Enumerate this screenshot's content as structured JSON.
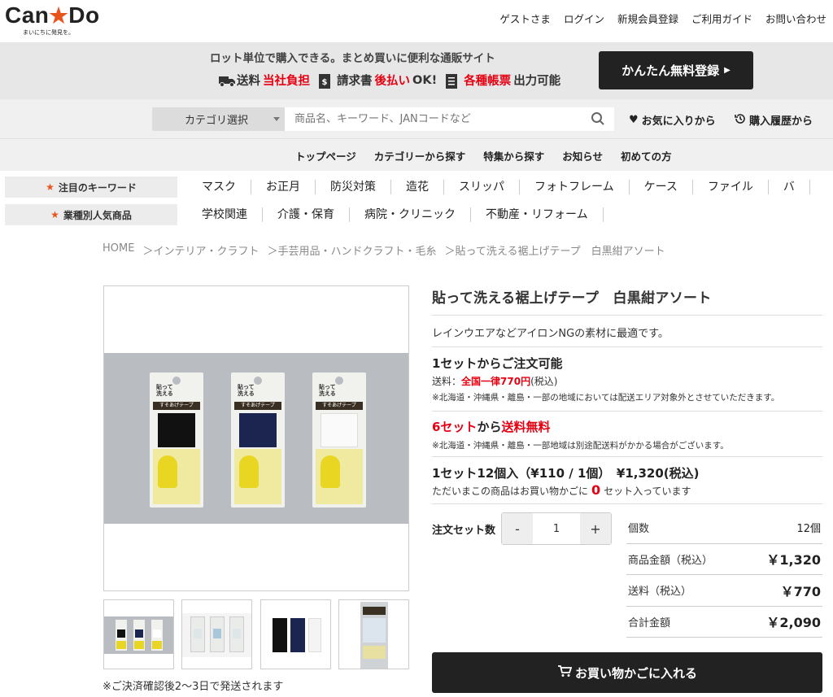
{
  "header": {
    "logo_text_1": "Can",
    "logo_text_2": "Do",
    "logo_tagline": "まいにちに発見を。",
    "links": [
      "ゲストさま",
      "ログイン",
      "新規会員登録",
      "ご利用ガイド",
      "お問い合わせ"
    ]
  },
  "banner": {
    "headline": "ロット単位で購入できる。まとめ買いに便利な通販サイト",
    "feat1_a": "送料",
    "feat1_b": "当社負担",
    "feat2_a": "請求書",
    "feat2_b": "後払い",
    "feat2_c": "OK!",
    "feat3_a": "各種帳票",
    "feat3_b": "出力可能",
    "register_button": "かんたん無料登録"
  },
  "search": {
    "category_select": "カテゴリ選択",
    "placeholder": "商品名、キーワード、JANコードなど",
    "favorites": "お気に入りから",
    "history": "購入履歴から"
  },
  "global_nav": [
    "トップページ",
    "カテゴリーから探す",
    "特集から探す",
    "お知らせ",
    "初めての方"
  ],
  "keywords": {
    "label": "注目のキーワード",
    "items": [
      "マスク",
      "お正月",
      "防災対策",
      "造花",
      "スリッパ",
      "フォトフレーム",
      "ケース",
      "ファイル",
      "バ"
    ]
  },
  "industry": {
    "label": "業種別人気商品",
    "items": [
      "学校関連",
      "介護・保育",
      "病院・クリニック",
      "不動産・リフォーム"
    ]
  },
  "breadcrumb": [
    "HOME",
    "＞インテリア・クラフト",
    "＞手芸用品・ハンドクラフト・毛糸",
    "＞貼って洗える裾上げテープ　白黒紺アソート"
  ],
  "product": {
    "title": "貼って洗える裾上げテープ　白黒紺アソート",
    "description": "レインウエアなどアイロンNGの素材に最適です。",
    "min_order": "1セットからご注文可能",
    "ship_label": "送料：",
    "ship_value": "全国一律770円",
    "ship_tax": "(税込)",
    "ship_note": "※北海道・沖縄県・離島・一部の地域においては配送エリア対象外とさせていただきます。",
    "free_a": "6セット",
    "free_b": "から",
    "free_c": "送料無料",
    "free_note": "※北海道・沖縄県・離島・一部地域は別途配送料がかかる場合がございます。",
    "price_line": "1セット12個入（¥110 / 1個）　¥1,320(税込)",
    "cart_pre": "ただいまこの商品はお買い物かごに",
    "cart_count": "0",
    "cart_post": "セット入っています",
    "qty_label": "注文セット数",
    "qty_minus": "-",
    "qty_value": "1",
    "qty_plus": "+",
    "package_text": "貼って\n洗える",
    "package_band": "すそあげテープ",
    "ship_after_payment": "※ご決済確認後2〜3日で発送されます",
    "add_to_cart": "お買い物かごに入れる"
  },
  "summary": [
    {
      "key": "個数",
      "value": "12個"
    },
    {
      "key": "商品金額（税込）",
      "value": "￥1,320"
    },
    {
      "key": "送料（税込）",
      "value": "￥770"
    },
    {
      "key": "合計金額",
      "value": "￥2,090"
    }
  ],
  "colors": {
    "accent_red": "#e60012",
    "logo_orange": "#e8541d",
    "dark": "#222222"
  }
}
